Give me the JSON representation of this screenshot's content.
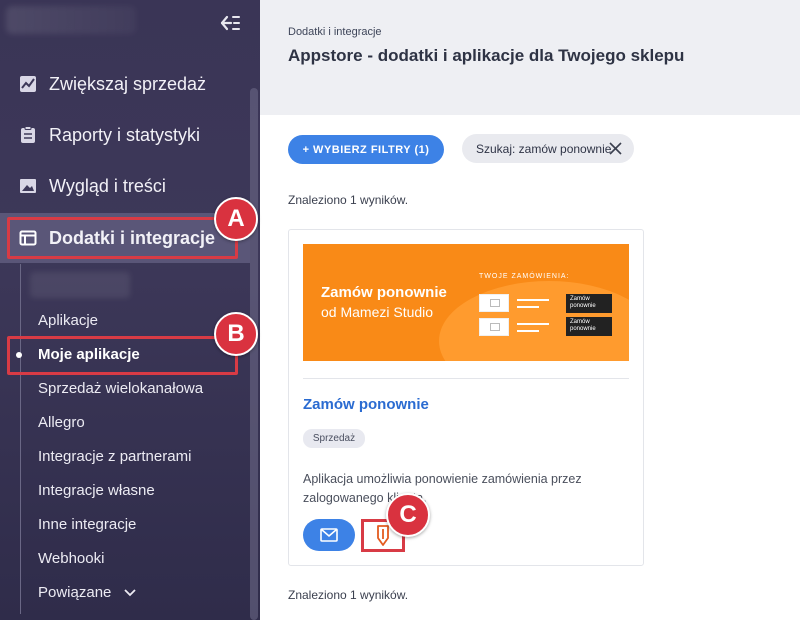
{
  "sidebar": {
    "main_items": [
      {
        "label": "Zwiększaj sprzedaż",
        "icon": "chart-line-icon"
      },
      {
        "label": "Raporty i statystyki",
        "icon": "clipboard-icon"
      },
      {
        "label": "Wygląd i treści",
        "icon": "image-icon"
      },
      {
        "label": "Dodatki i integracje",
        "icon": "window-icon",
        "active": true
      }
    ],
    "sub_items": [
      {
        "label": "Aplikacje"
      },
      {
        "label": "Moje aplikacje",
        "active": true
      },
      {
        "label": "Sprzedaż wielokanałowa"
      },
      {
        "label": "Allegro"
      },
      {
        "label": "Integracje z partnerami"
      },
      {
        "label": "Integracje własne"
      },
      {
        "label": "Inne integracje"
      },
      {
        "label": "Webhooki"
      },
      {
        "label": "Powiązane"
      }
    ]
  },
  "markers": {
    "a": "A",
    "b": "B",
    "c": "C"
  },
  "header": {
    "breadcrumb": "Dodatki i integracje",
    "title": "Appstore - dodatki i aplikacje dla Twojego sklepu"
  },
  "filters": {
    "button_label": "+ WYBIERZ FILTRY (1)",
    "search_chip": "Szukaj: zamów ponownie"
  },
  "results": {
    "top_text": "Znaleziono 1 wyników.",
    "bottom_text": "Znaleziono 1 wyników."
  },
  "app_card": {
    "banner": {
      "title": "Zamów ponownie",
      "subtitle": "od Mamezi Studio",
      "label": "TWOJE ZAMÓWIENIA:",
      "mini_button_1": "Zamów ponownie",
      "mini_button_2": "Zamów ponownie"
    },
    "name": "Zamów ponownie",
    "tag": "Sprzedaż",
    "description": "Aplikacja umożliwia ponowienie zamówienia przez zalogowanego klienta.",
    "actions": [
      {
        "icon": "mail-icon"
      },
      {
        "icon": "pin-icon"
      }
    ]
  },
  "colors": {
    "sidebar_bg": "#3d3859",
    "accent_blue": "#3d82e6",
    "highlight_red": "#d83b45",
    "banner_orange": "#f98a17",
    "link_blue": "#2a6bd1"
  }
}
